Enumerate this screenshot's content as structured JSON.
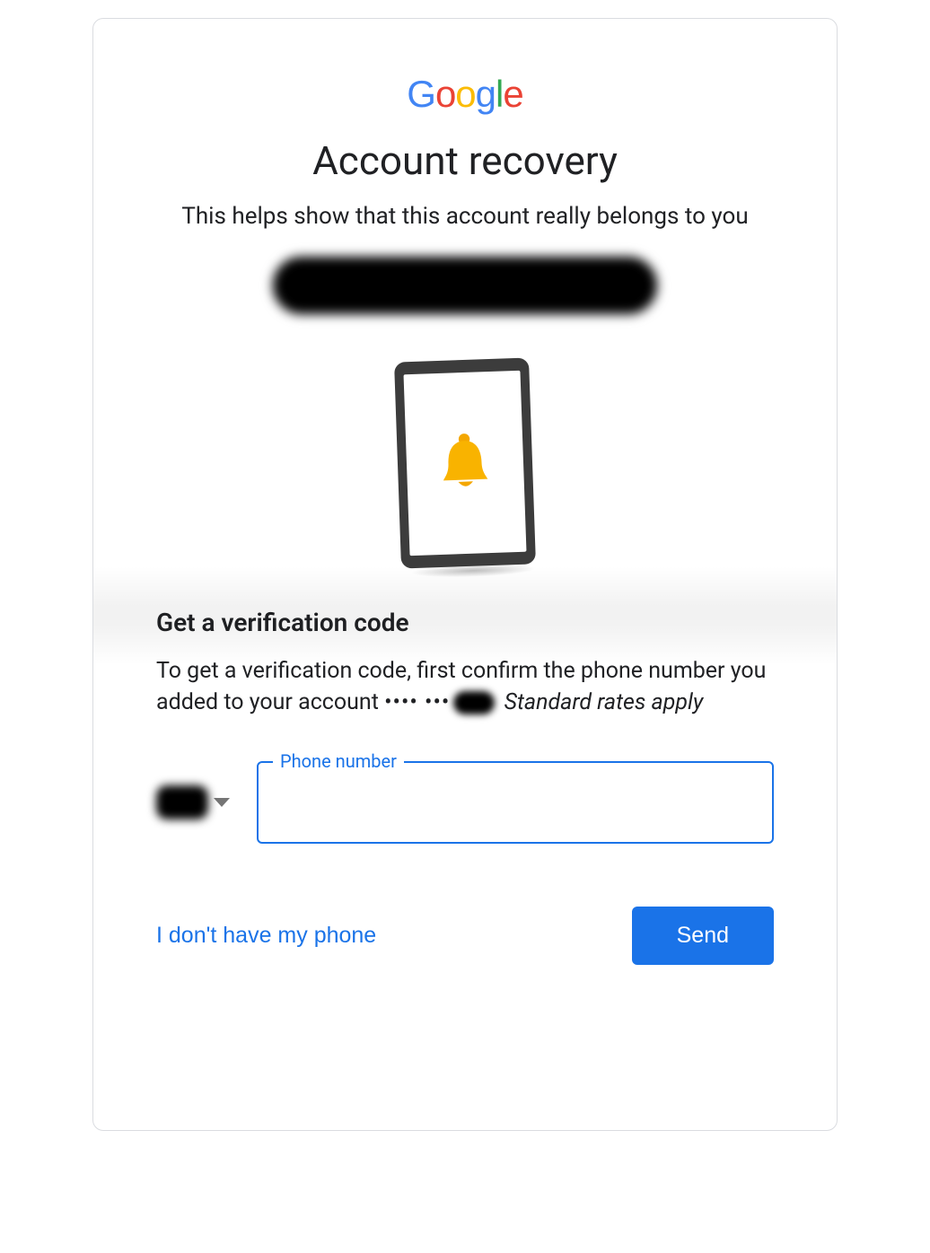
{
  "header": {
    "logo_letters": [
      "G",
      "o",
      "o",
      "g",
      "l",
      "e"
    ],
    "title": "Account recovery",
    "subtitle": "This helps show that this account really belongs to you"
  },
  "account_chip": {
    "email": "[redacted]"
  },
  "verification": {
    "section_title": "Get a verification code",
    "body_pre": "To get a verification code, first confirm the phone number you added to your account ",
    "masked_hint": "•••• •••",
    "rates_note": "Standard rates apply"
  },
  "phone_field": {
    "label": "Phone number",
    "value": "",
    "placeholder": ""
  },
  "actions": {
    "secondary": "I don't have my phone",
    "primary": "Send"
  }
}
